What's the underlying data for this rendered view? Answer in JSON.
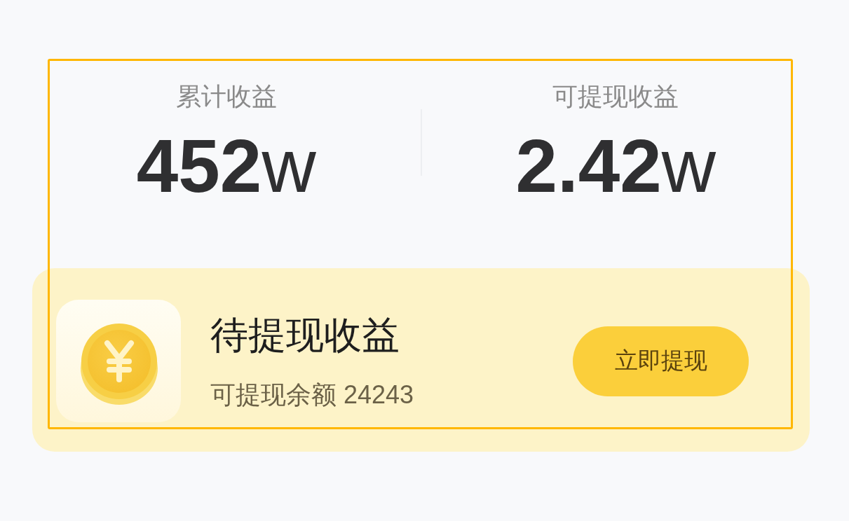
{
  "stats": [
    {
      "label": "累计收益",
      "value": "**452**w"
    },
    {
      "label": "可提现收益",
      "value": "**2.42**w"
    }
  ],
  "pending": {
    "title": "待提现收益",
    "balance": "可提现余额 24243",
    "button": "立即提现"
  }
}
